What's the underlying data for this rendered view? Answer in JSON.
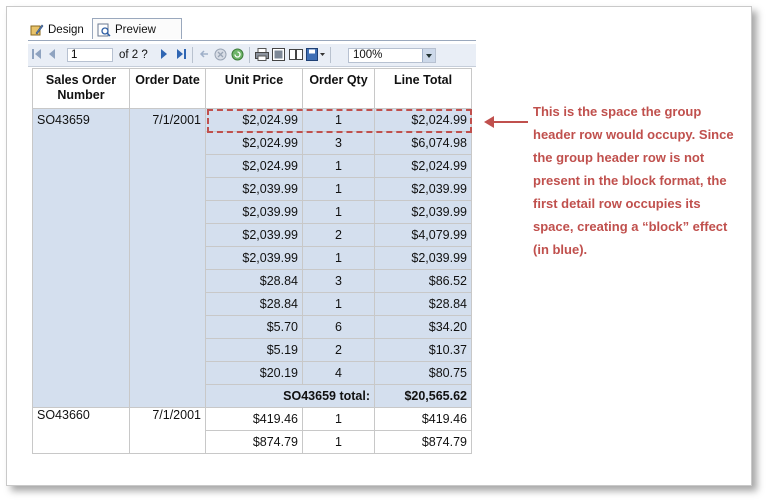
{
  "tabs": {
    "design": "Design",
    "preview": "Preview"
  },
  "toolbar": {
    "page_value": "1",
    "page_of": "of 2 ?",
    "zoom": "100%"
  },
  "columns": [
    "Sales Order Number",
    "Order Date",
    "Unit Price",
    "Order Qty",
    "Line Total"
  ],
  "group1": {
    "order": "SO43659",
    "date": "7/1/2001",
    "rows": [
      [
        "$2,024.99",
        "1",
        "$2,024.99"
      ],
      [
        "$2,024.99",
        "3",
        "$6,074.98"
      ],
      [
        "$2,024.99",
        "1",
        "$2,024.99"
      ],
      [
        "$2,039.99",
        "1",
        "$2,039.99"
      ],
      [
        "$2,039.99",
        "1",
        "$2,039.99"
      ],
      [
        "$2,039.99",
        "2",
        "$4,079.99"
      ],
      [
        "$2,039.99",
        "1",
        "$2,039.99"
      ],
      [
        "$28.84",
        "3",
        "$86.52"
      ],
      [
        "$28.84",
        "1",
        "$28.84"
      ],
      [
        "$5.70",
        "6",
        "$34.20"
      ],
      [
        "$5.19",
        "2",
        "$10.37"
      ],
      [
        "$20.19",
        "4",
        "$80.75"
      ]
    ],
    "total_label": "SO43659 total:",
    "total_value": "$20,565.62"
  },
  "group2": {
    "order": "SO43660",
    "date": "7/1/2001",
    "rows": [
      [
        "$419.46",
        "1",
        "$419.46"
      ],
      [
        "$874.79",
        "1",
        "$874.79"
      ]
    ]
  },
  "annotation": {
    "text": "This is the space the group header row would occupy. Since the group header row is not present in the block format, the first detail row occupies its space, creating a “block” effect (in blue).",
    "color": "#c0504d"
  },
  "colors": {
    "block_blue": "#d4dfee",
    "toolbar_bg": "#e9eef6"
  }
}
